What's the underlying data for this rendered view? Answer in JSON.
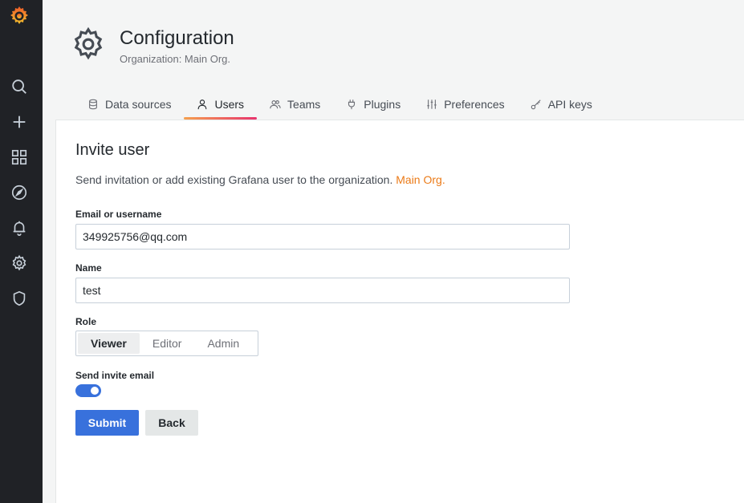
{
  "sidebar": {
    "icons": [
      "grafana-logo",
      "search-icon",
      "plus-icon",
      "dashboards-icon",
      "explore-icon",
      "alerting-icon",
      "gear-icon",
      "shield-icon"
    ]
  },
  "header": {
    "title": "Configuration",
    "subtitle": "Organization: Main Org."
  },
  "tabs": [
    {
      "label": "Data sources",
      "icon": "database-icon"
    },
    {
      "label": "Users",
      "icon": "user-icon",
      "active": true
    },
    {
      "label": "Teams",
      "icon": "users-icon"
    },
    {
      "label": "Plugins",
      "icon": "plug-icon"
    },
    {
      "label": "Preferences",
      "icon": "sliders-icon"
    },
    {
      "label": "API keys",
      "icon": "key-icon"
    }
  ],
  "form": {
    "title": "Invite user",
    "description": "Send invitation or add existing Grafana user to the organization.",
    "org_name": "Main Org.",
    "email_label": "Email or username",
    "email_value": "349925756@qq.com",
    "name_label": "Name",
    "name_value": "test",
    "role_label": "Role",
    "role_options": [
      "Viewer",
      "Editor",
      "Admin"
    ],
    "role_selected": "Viewer",
    "send_email_label": "Send invite email",
    "send_email_on": true,
    "submit_label": "Submit",
    "back_label": "Back"
  },
  "colors": {
    "sidebar_bg": "#202226",
    "primary": "#3871dc",
    "org_link": "#eb7b18",
    "tab_gradient_start": "#f5a04e",
    "tab_gradient_end": "#e8346e"
  }
}
